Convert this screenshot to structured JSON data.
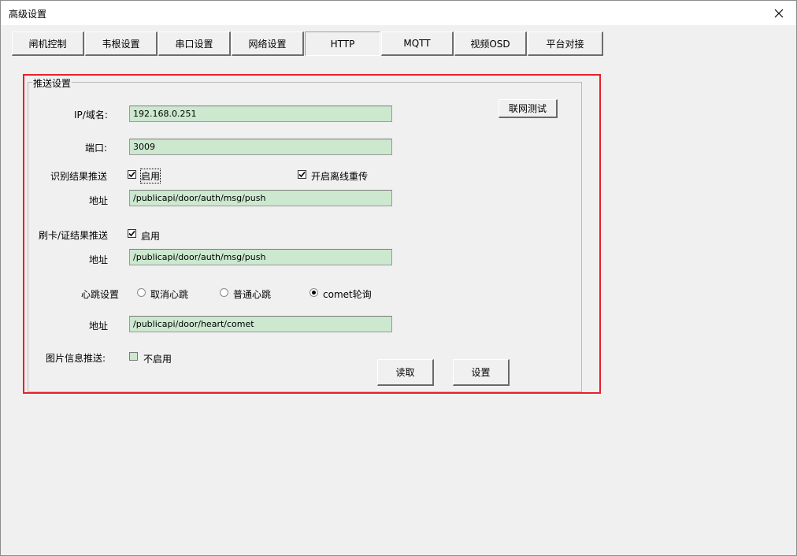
{
  "window": {
    "title": "高级设置"
  },
  "tabs": [
    "闸机控制",
    "韦根设置",
    "串口设置",
    "网络设置",
    "HTTP",
    "MQTT",
    "视频OSD",
    "平台对接"
  ],
  "group": {
    "title": "推送设置"
  },
  "fields": {
    "ip_label": "IP/域名:",
    "ip_value": "192.168.0.251",
    "port_label": "端口:",
    "port_value": "3009",
    "recog_label": "识别结果推送",
    "recog_enable": "启用",
    "recog_enabled": true,
    "offline_label": "开启离线重传",
    "offline_enabled": true,
    "recog_addr_label": "地址",
    "recog_addr_value": "/publicapi/door/auth/msg/push",
    "card_label": "刷卡/证结果推送",
    "card_enable": "启用",
    "card_enabled": true,
    "card_addr_label": "地址",
    "card_addr_value": "/publicapi/door/auth/msg/push",
    "heart_label": "心跳设置",
    "heart_options": [
      "取消心跳",
      "普通心跳",
      "comet轮询"
    ],
    "heart_selected": "comet轮询",
    "heart_addr_label": "地址",
    "heart_addr_value": "/publicapi/door/heart/comet",
    "image_label": "图片信息推送:",
    "image_enable": "不启用",
    "image_enabled": false
  },
  "buttons": {
    "net_test": "联网测试",
    "read": "读取",
    "set": "设置"
  },
  "colors": {
    "field_bg": "#cce8cf",
    "highlight": "#e8202a",
    "window_bg": "#f0f0f0"
  },
  "icons": {
    "close": "close-icon",
    "check": "checkmark-icon"
  }
}
